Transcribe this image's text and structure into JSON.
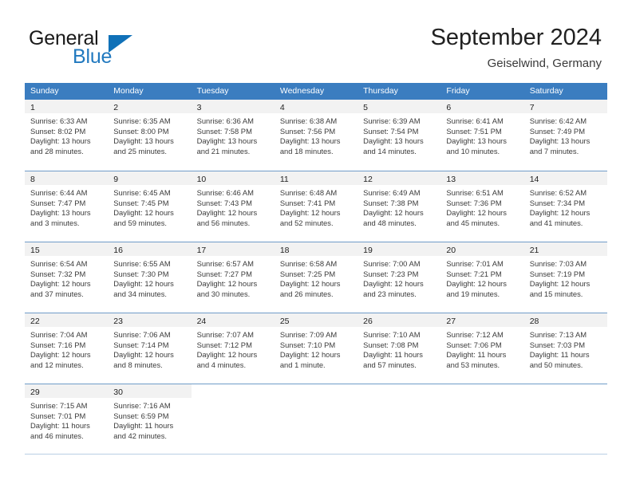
{
  "brand": {
    "word_one": "General",
    "word_two": "Blue",
    "logo_icon": "triangle-logo-icon",
    "accent_color": "#1071b8",
    "blue_text_color": "#2179bf"
  },
  "header": {
    "title": "September 2024",
    "subtitle": "Geiselwind, Germany"
  },
  "calendar": {
    "header_bg": "#3b7dc0",
    "day_band_bg": "#f2f2f2",
    "weekdays": [
      "Sunday",
      "Monday",
      "Tuesday",
      "Wednesday",
      "Thursday",
      "Friday",
      "Saturday"
    ],
    "weeks": [
      [
        {
          "day": "1",
          "lines": [
            "Sunrise: 6:33 AM",
            "Sunset: 8:02 PM",
            "Daylight: 13 hours",
            "and 28 minutes."
          ]
        },
        {
          "day": "2",
          "lines": [
            "Sunrise: 6:35 AM",
            "Sunset: 8:00 PM",
            "Daylight: 13 hours",
            "and 25 minutes."
          ]
        },
        {
          "day": "3",
          "lines": [
            "Sunrise: 6:36 AM",
            "Sunset: 7:58 PM",
            "Daylight: 13 hours",
            "and 21 minutes."
          ]
        },
        {
          "day": "4",
          "lines": [
            "Sunrise: 6:38 AM",
            "Sunset: 7:56 PM",
            "Daylight: 13 hours",
            "and 18 minutes."
          ]
        },
        {
          "day": "5",
          "lines": [
            "Sunrise: 6:39 AM",
            "Sunset: 7:54 PM",
            "Daylight: 13 hours",
            "and 14 minutes."
          ]
        },
        {
          "day": "6",
          "lines": [
            "Sunrise: 6:41 AM",
            "Sunset: 7:51 PM",
            "Daylight: 13 hours",
            "and 10 minutes."
          ]
        },
        {
          "day": "7",
          "lines": [
            "Sunrise: 6:42 AM",
            "Sunset: 7:49 PM",
            "Daylight: 13 hours",
            "and 7 minutes."
          ]
        }
      ],
      [
        {
          "day": "8",
          "lines": [
            "Sunrise: 6:44 AM",
            "Sunset: 7:47 PM",
            "Daylight: 13 hours",
            "and 3 minutes."
          ]
        },
        {
          "day": "9",
          "lines": [
            "Sunrise: 6:45 AM",
            "Sunset: 7:45 PM",
            "Daylight: 12 hours",
            "and 59 minutes."
          ]
        },
        {
          "day": "10",
          "lines": [
            "Sunrise: 6:46 AM",
            "Sunset: 7:43 PM",
            "Daylight: 12 hours",
            "and 56 minutes."
          ]
        },
        {
          "day": "11",
          "lines": [
            "Sunrise: 6:48 AM",
            "Sunset: 7:41 PM",
            "Daylight: 12 hours",
            "and 52 minutes."
          ]
        },
        {
          "day": "12",
          "lines": [
            "Sunrise: 6:49 AM",
            "Sunset: 7:38 PM",
            "Daylight: 12 hours",
            "and 48 minutes."
          ]
        },
        {
          "day": "13",
          "lines": [
            "Sunrise: 6:51 AM",
            "Sunset: 7:36 PM",
            "Daylight: 12 hours",
            "and 45 minutes."
          ]
        },
        {
          "day": "14",
          "lines": [
            "Sunrise: 6:52 AM",
            "Sunset: 7:34 PM",
            "Daylight: 12 hours",
            "and 41 minutes."
          ]
        }
      ],
      [
        {
          "day": "15",
          "lines": [
            "Sunrise: 6:54 AM",
            "Sunset: 7:32 PM",
            "Daylight: 12 hours",
            "and 37 minutes."
          ]
        },
        {
          "day": "16",
          "lines": [
            "Sunrise: 6:55 AM",
            "Sunset: 7:30 PM",
            "Daylight: 12 hours",
            "and 34 minutes."
          ]
        },
        {
          "day": "17",
          "lines": [
            "Sunrise: 6:57 AM",
            "Sunset: 7:27 PM",
            "Daylight: 12 hours",
            "and 30 minutes."
          ]
        },
        {
          "day": "18",
          "lines": [
            "Sunrise: 6:58 AM",
            "Sunset: 7:25 PM",
            "Daylight: 12 hours",
            "and 26 minutes."
          ]
        },
        {
          "day": "19",
          "lines": [
            "Sunrise: 7:00 AM",
            "Sunset: 7:23 PM",
            "Daylight: 12 hours",
            "and 23 minutes."
          ]
        },
        {
          "day": "20",
          "lines": [
            "Sunrise: 7:01 AM",
            "Sunset: 7:21 PM",
            "Daylight: 12 hours",
            "and 19 minutes."
          ]
        },
        {
          "day": "21",
          "lines": [
            "Sunrise: 7:03 AM",
            "Sunset: 7:19 PM",
            "Daylight: 12 hours",
            "and 15 minutes."
          ]
        }
      ],
      [
        {
          "day": "22",
          "lines": [
            "Sunrise: 7:04 AM",
            "Sunset: 7:16 PM",
            "Daylight: 12 hours",
            "and 12 minutes."
          ]
        },
        {
          "day": "23",
          "lines": [
            "Sunrise: 7:06 AM",
            "Sunset: 7:14 PM",
            "Daylight: 12 hours",
            "and 8 minutes."
          ]
        },
        {
          "day": "24",
          "lines": [
            "Sunrise: 7:07 AM",
            "Sunset: 7:12 PM",
            "Daylight: 12 hours",
            "and 4 minutes."
          ]
        },
        {
          "day": "25",
          "lines": [
            "Sunrise: 7:09 AM",
            "Sunset: 7:10 PM",
            "Daylight: 12 hours",
            "and 1 minute."
          ]
        },
        {
          "day": "26",
          "lines": [
            "Sunrise: 7:10 AM",
            "Sunset: 7:08 PM",
            "Daylight: 11 hours",
            "and 57 minutes."
          ]
        },
        {
          "day": "27",
          "lines": [
            "Sunrise: 7:12 AM",
            "Sunset: 7:06 PM",
            "Daylight: 11 hours",
            "and 53 minutes."
          ]
        },
        {
          "day": "28",
          "lines": [
            "Sunrise: 7:13 AM",
            "Sunset: 7:03 PM",
            "Daylight: 11 hours",
            "and 50 minutes."
          ]
        }
      ],
      [
        {
          "day": "29",
          "lines": [
            "Sunrise: 7:15 AM",
            "Sunset: 7:01 PM",
            "Daylight: 11 hours",
            "and 46 minutes."
          ]
        },
        {
          "day": "30",
          "lines": [
            "Sunrise: 7:16 AM",
            "Sunset: 6:59 PM",
            "Daylight: 11 hours",
            "and 42 minutes."
          ]
        },
        {
          "day": "",
          "lines": []
        },
        {
          "day": "",
          "lines": []
        },
        {
          "day": "",
          "lines": []
        },
        {
          "day": "",
          "lines": []
        },
        {
          "day": "",
          "lines": []
        }
      ]
    ]
  }
}
